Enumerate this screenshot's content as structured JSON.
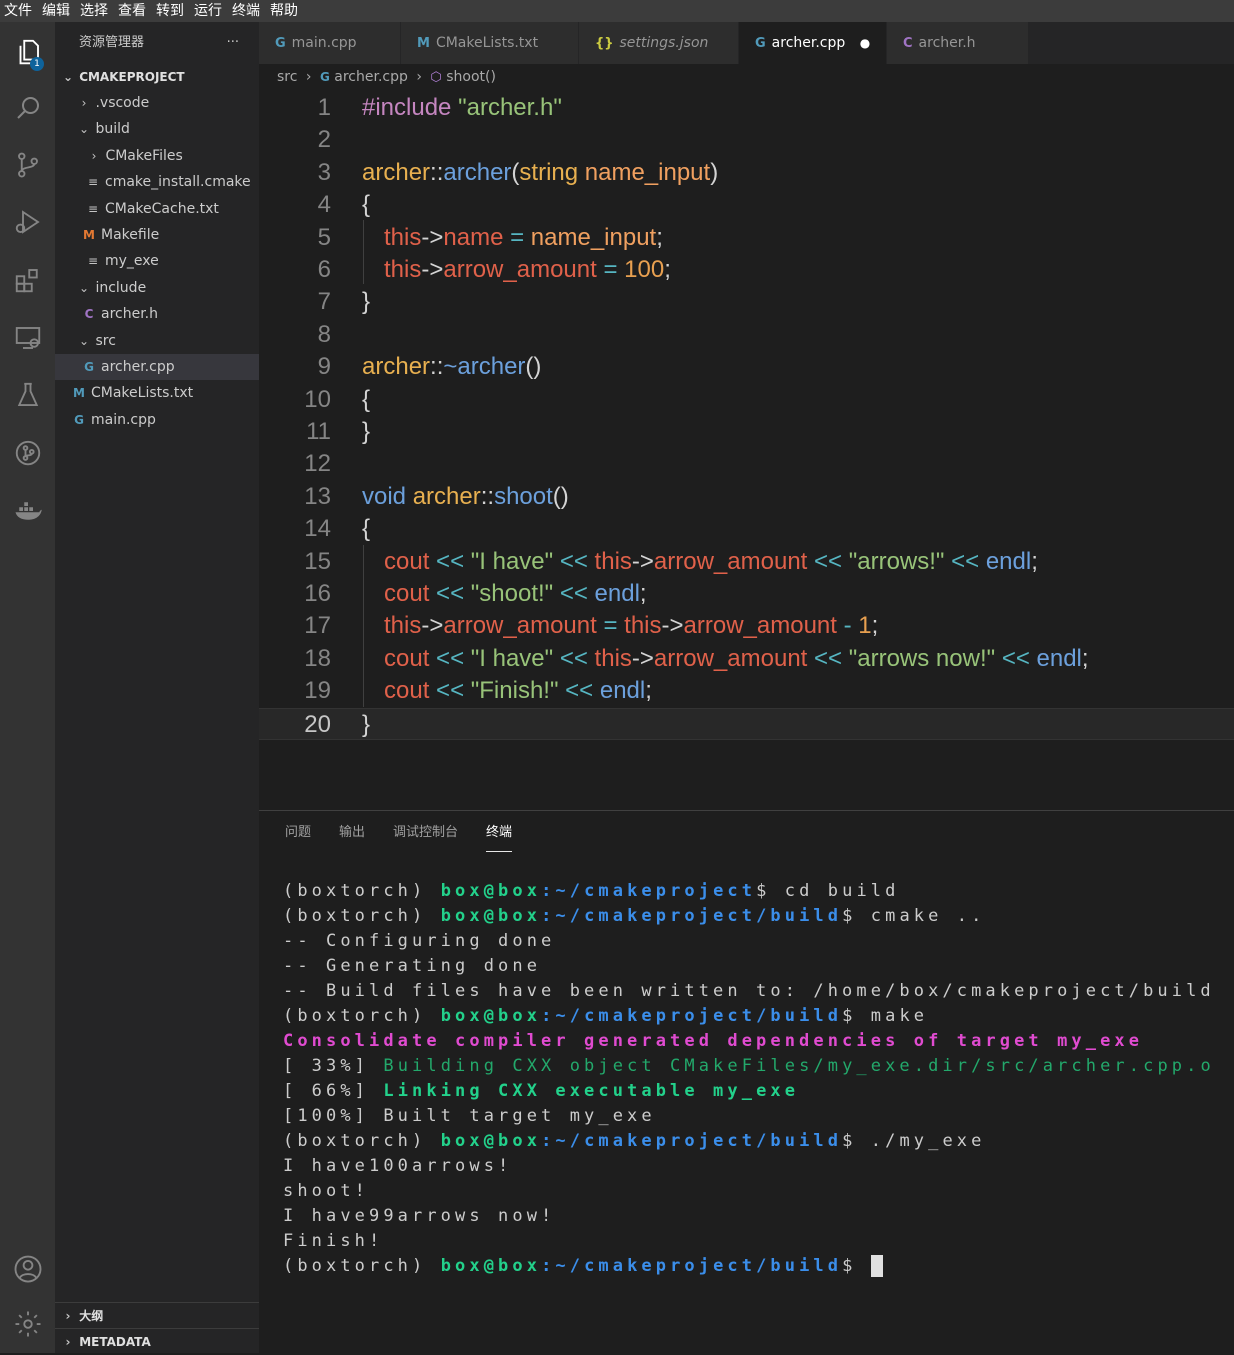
{
  "menu": [
    "文件",
    "编辑",
    "选择",
    "查看",
    "转到",
    "运行",
    "终端",
    "帮助"
  ],
  "activity": {
    "explorer_badge": "1"
  },
  "sidebar": {
    "title": "资源管理器",
    "more": "···",
    "project": "CMAKEPROJECT",
    "items": [
      {
        "label": ".vscode",
        "chev": "›",
        "icon": ""
      },
      {
        "label": "build",
        "chev": "⌄",
        "icon": ""
      },
      {
        "label": "CMakeFiles",
        "chev": "›",
        "icon": ""
      },
      {
        "label": "cmake_install.cmake",
        "chev": "",
        "icon": "≡"
      },
      {
        "label": "CMakeCache.txt",
        "chev": "",
        "icon": "≡"
      },
      {
        "label": "Makefile",
        "chev": "",
        "icon": "M"
      },
      {
        "label": "my_exe",
        "chev": "",
        "icon": "≡"
      },
      {
        "label": "include",
        "chev": "⌄",
        "icon": ""
      },
      {
        "label": "archer.h",
        "chev": "",
        "icon": "C"
      },
      {
        "label": "src",
        "chev": "⌄",
        "icon": ""
      },
      {
        "label": "archer.cpp",
        "chev": "",
        "icon": "G"
      },
      {
        "label": "CMakeLists.txt",
        "chev": "",
        "icon": "M"
      },
      {
        "label": "main.cpp",
        "chev": "",
        "icon": "G"
      }
    ],
    "outline": "大纲",
    "metadata": "METADATA"
  },
  "tabs": [
    {
      "label": "main.cpp",
      "icon": "G"
    },
    {
      "label": "CMakeLists.txt",
      "icon": "M"
    },
    {
      "label": "settings.json",
      "icon": "{}"
    },
    {
      "label": "archer.cpp",
      "icon": "G",
      "modified": "●"
    },
    {
      "label": "archer.h",
      "icon": "C"
    }
  ],
  "breadcrumb": {
    "part1": "src",
    "sep": "›",
    "part2": "archer.cpp",
    "part3": "shoot()"
  },
  "code": {
    "line_numbers": [
      "1",
      "2",
      "3",
      "4",
      "5",
      "6",
      "7",
      "8",
      "9",
      "10",
      "11",
      "12",
      "13",
      "14",
      "15",
      "16",
      "17",
      "18",
      "19",
      "20"
    ],
    "lines": [
      "#include \"archer.h\"",
      "",
      "archer::archer(string name_input)",
      "{",
      "this->name = name_input;",
      "this->arrow_amount = 100;",
      "}",
      "",
      "archer::~archer()",
      "{",
      "}",
      "",
      "void archer::shoot()",
      "{",
      "cout << \"I have\" << this->arrow_amount << \"arrows!\" << endl;",
      "cout << \"shoot!\" << endl;",
      "this->arrow_amount = this->arrow_amount - 1;",
      "cout << \"I have\" << this->arrow_amount << \"arrows now!\" << endl;",
      "cout << \"Finish!\" << endl;",
      "}"
    ]
  },
  "panel": {
    "tabs": [
      "问题",
      "输出",
      "调试控制台",
      "终端"
    ],
    "active_tab": "终端",
    "terminal": {
      "env": "(boxtorch)",
      "user": "box@box",
      "path_root": ":~/cmakeproject",
      "path_build": ":~/cmakeproject/build",
      "cmd_cd": "cd build",
      "cmd_cmake": "cmake ..",
      "cfg": "-- Configuring done",
      "gen": "-- Generating done",
      "written": "-- Build files have been written to: /home/box/cmakeproject/build",
      "cmd_make": "make",
      "consolidate": "Consolidate compiler generated dependencies of target my_exe",
      "p33": "[ 33%] ",
      "building": "Building CXX object CMakeFiles/my_exe.dir/src/archer.cpp.o",
      "p66": "[ 66%] ",
      "linking": "Linking CXX executable my_exe",
      "built": "[100%] Built target my_exe",
      "cmd_run": "./my_exe",
      "out1": "I have100arrows!",
      "out2": "shoot!",
      "out3": "I have99arrows now!",
      "out4": "Finish!"
    }
  }
}
